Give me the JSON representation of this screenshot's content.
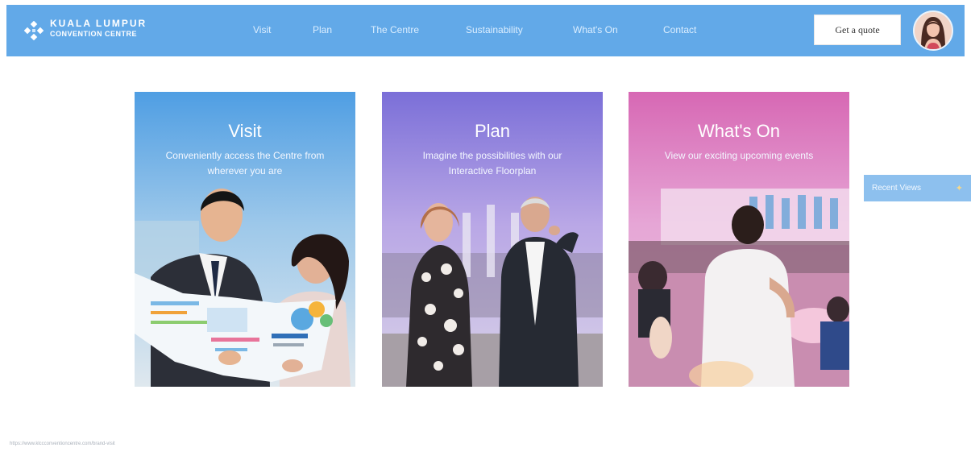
{
  "header": {
    "logo_line1": "KUALA LUMPUR",
    "logo_line2": "CONVENTION CENTRE",
    "menu": [
      {
        "label": "Visit"
      },
      {
        "label": "Plan"
      },
      {
        "label": "The Centre"
      },
      {
        "label": "Sustainability"
      },
      {
        "label": "What's On"
      },
      {
        "label": "Contact"
      }
    ],
    "quote_label": "Get a quote"
  },
  "cards": [
    {
      "title": "Visit",
      "subtitle": "Conveniently access the Centre from wherever you are"
    },
    {
      "title": "Plan",
      "subtitle": "Imagine the possibilities with our Interactive Floorplan"
    },
    {
      "title": "What's On",
      "subtitle": "View our exciting upcoming events"
    }
  ],
  "side_tab": {
    "label": "Recent Views"
  },
  "status_url": "https://www.klccconventioncentre.com/brand-visit",
  "colors": {
    "nav": "#62a9e8",
    "side_tab": "#8dc0ee"
  }
}
